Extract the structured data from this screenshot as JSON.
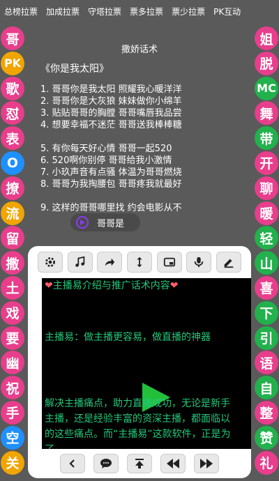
{
  "tabs": [
    "总榜拉票",
    "加成拉票",
    "守塔拉票",
    "票多拉票",
    "票少拉票",
    "PK互动"
  ],
  "left_circles": [
    {
      "label": "哥",
      "color": "#e83e8c"
    },
    {
      "label": "PK",
      "color": "#f0a500"
    },
    {
      "label": "歌",
      "color": "#e83e8c"
    },
    {
      "label": "怼",
      "color": "#e83e8c"
    },
    {
      "label": "表",
      "color": "#e83e8c"
    },
    {
      "label": "O",
      "color": "#1e90ff"
    },
    {
      "label": "撩",
      "color": "#e83e8c"
    },
    {
      "label": "流",
      "color": "#f0a500"
    },
    {
      "label": "留",
      "color": "#e83e8c"
    },
    {
      "label": "撒",
      "color": "#e83e8c"
    },
    {
      "label": "土",
      "color": "#e83e8c"
    },
    {
      "label": "戏",
      "color": "#e83e8c"
    },
    {
      "label": "要",
      "color": "#e83e8c"
    },
    {
      "label": "幽",
      "color": "#e83e8c"
    },
    {
      "label": "祝",
      "color": "#e83e8c"
    },
    {
      "label": "手",
      "color": "#e83e8c"
    },
    {
      "label": "空",
      "color": "#1e90ff"
    },
    {
      "label": "关",
      "color": "#f0a500"
    }
  ],
  "right_circles": [
    {
      "label": "姐",
      "color": "#e83e8c"
    },
    {
      "label": "脱",
      "color": "#e83e8c"
    },
    {
      "label": "MC",
      "color": "#22b14c"
    },
    {
      "label": "舞",
      "color": "#e83e8c"
    },
    {
      "label": "带",
      "color": "#22b14c"
    },
    {
      "label": "开",
      "color": "#e83e8c"
    },
    {
      "label": "聊",
      "color": "#e83e8c"
    },
    {
      "label": "暖",
      "color": "#e83e8c"
    },
    {
      "label": "轻",
      "color": "#22b14c"
    },
    {
      "label": "山",
      "color": "#22b14c"
    },
    {
      "label": "喜",
      "color": "#e83e8c"
    },
    {
      "label": "下",
      "color": "#22b14c"
    },
    {
      "label": "引",
      "color": "#22b14c"
    },
    {
      "label": "语",
      "color": "#e83e8c"
    },
    {
      "label": "自",
      "color": "#22b14c"
    },
    {
      "label": "整",
      "color": "#e83e8c"
    },
    {
      "label": "赞",
      "color": "#22b14c"
    },
    {
      "label": "礼",
      "color": "#e83e8c"
    }
  ],
  "script": {
    "title": "撒娇话术",
    "subtitle": "《你是我太阳》",
    "lines": [
      "1. 哥哥你是我太阳 照耀我心暖洋洋",
      "2. 哥哥你是大灰狼 妹妹做你小绵羊",
      "3. 贴贴哥哥的胸膛 哥哥嘴唇我品尝",
      "4. 想要幸福不迷茫 哥哥送我棒棒糖",
      "",
      "5. 有你每天好心情 哥哥一起520",
      "6.  520啊你别停  哥哥给我小激情",
      "7. 小玖声音有点骚 体温为哥哥燃烧",
      "8. 哥哥为我掏腰包 哥哥疼我就最好",
      "",
      "9. 这样的哥哥哪里找 约会电影从不"
    ],
    "voice_label": "哥哥是"
  },
  "panel": {
    "heading": "❤️主播易介绍与推广话术内容❤️",
    "para1": "主播易：做主播更容易，做直播的神器",
    "para2": "解决主播痛点，助力直播成功，无论是新手主播，还是经验丰富的资深主播，都面临以的这些痛点。而“主播易”这款软件，正是为了"
  },
  "colors": {
    "background": "#5a5a5a",
    "accent_text": "#24c77a",
    "play": "#22c03a",
    "voice_icon": "#8a3cf0"
  }
}
